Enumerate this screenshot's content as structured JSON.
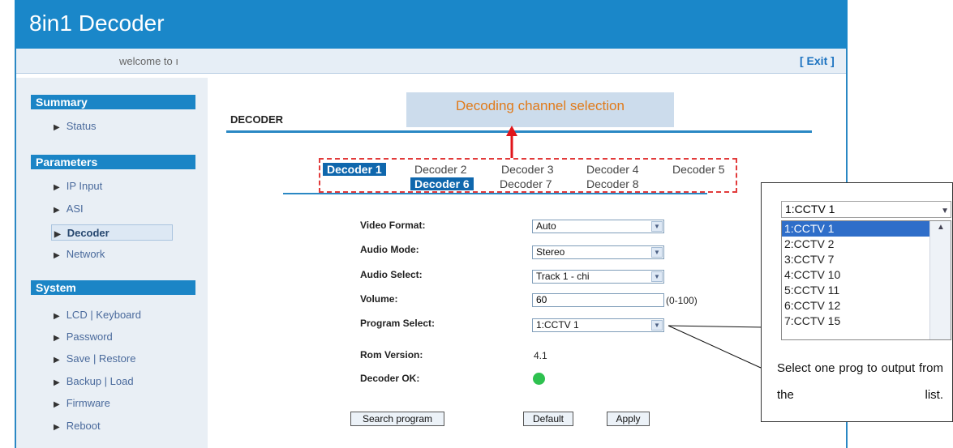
{
  "header": {
    "title": "8in1 Decoder"
  },
  "welcome": {
    "text": "welcome to ı",
    "exit": "[ Exit ]"
  },
  "sidebar": {
    "sections": [
      {
        "title": "Summary",
        "items": [
          "Status"
        ]
      },
      {
        "title": "Parameters",
        "items": [
          "IP Input",
          "ASI",
          "Decoder",
          "Network"
        ]
      },
      {
        "title": "System",
        "items": [
          "LCD | Keyboard",
          "Password",
          "Save | Restore",
          "Backup | Load",
          "Firmware",
          "Reboot"
        ]
      }
    ],
    "active": "Decoder"
  },
  "main": {
    "title": "DECODER",
    "callout": "Decoding channel selection",
    "tabs": [
      "Decoder 1",
      "Decoder 2",
      "Decoder 3",
      "Decoder 4",
      "Decoder 5",
      "Decoder 6",
      "Decoder 7",
      "Decoder 8"
    ],
    "active_tabs": [
      "Decoder 1",
      "Decoder 6"
    ]
  },
  "form": {
    "video_format": {
      "label": "Video Format:",
      "value": "Auto"
    },
    "audio_mode": {
      "label": "Audio Mode:",
      "value": "Stereo"
    },
    "audio_select": {
      "label": "Audio Select:",
      "value": "Track 1 - chi"
    },
    "volume": {
      "label": "Volume:",
      "value": "60",
      "range": "(0-100)"
    },
    "program_select": {
      "label": "Program Select:",
      "value": "1:CCTV 1"
    },
    "rom_version": {
      "label": "Rom Version:",
      "value": "4.1"
    },
    "decoder_ok": {
      "label": "Decoder OK:"
    }
  },
  "buttons": {
    "search": "Search program",
    "default": "Default",
    "apply": "Apply"
  },
  "dropdown": {
    "selected": "1:CCTV 1",
    "options": [
      "1:CCTV 1",
      "2:CCTV 2",
      "3:CCTV 7",
      "4:CCTV 10",
      "5:CCTV 11",
      "6:CCTV 12",
      "7:CCTV 15"
    ]
  },
  "annotation": {
    "text": "Select one prog to output from the list."
  }
}
